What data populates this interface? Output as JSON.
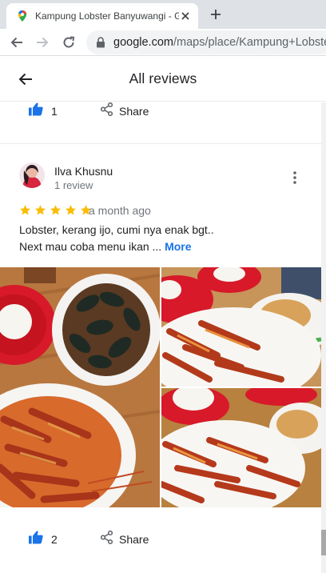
{
  "browser": {
    "tab_title": "Kampung Lobster Banyuwangi - G",
    "url_host": "google.com",
    "url_path": "/maps/place/Kampung+Lobster"
  },
  "header": {
    "title": "All reviews"
  },
  "previous_review": {
    "like_count": "1",
    "share_label": "Share"
  },
  "review": {
    "author": "Ilva Khusnu",
    "author_meta": "1 review",
    "rating": 5,
    "date": "a month ago",
    "text_line1": "Lobster, kerang ijo, cumi nya enak bgt..",
    "text_line2": "Next mau coba menu ikan ...",
    "more_label": "More",
    "like_count": "2",
    "share_label": "Share"
  },
  "colors": {
    "star": "#fbbc04",
    "like_blue": "#1a73e8",
    "link_blue": "#1a73e8"
  }
}
